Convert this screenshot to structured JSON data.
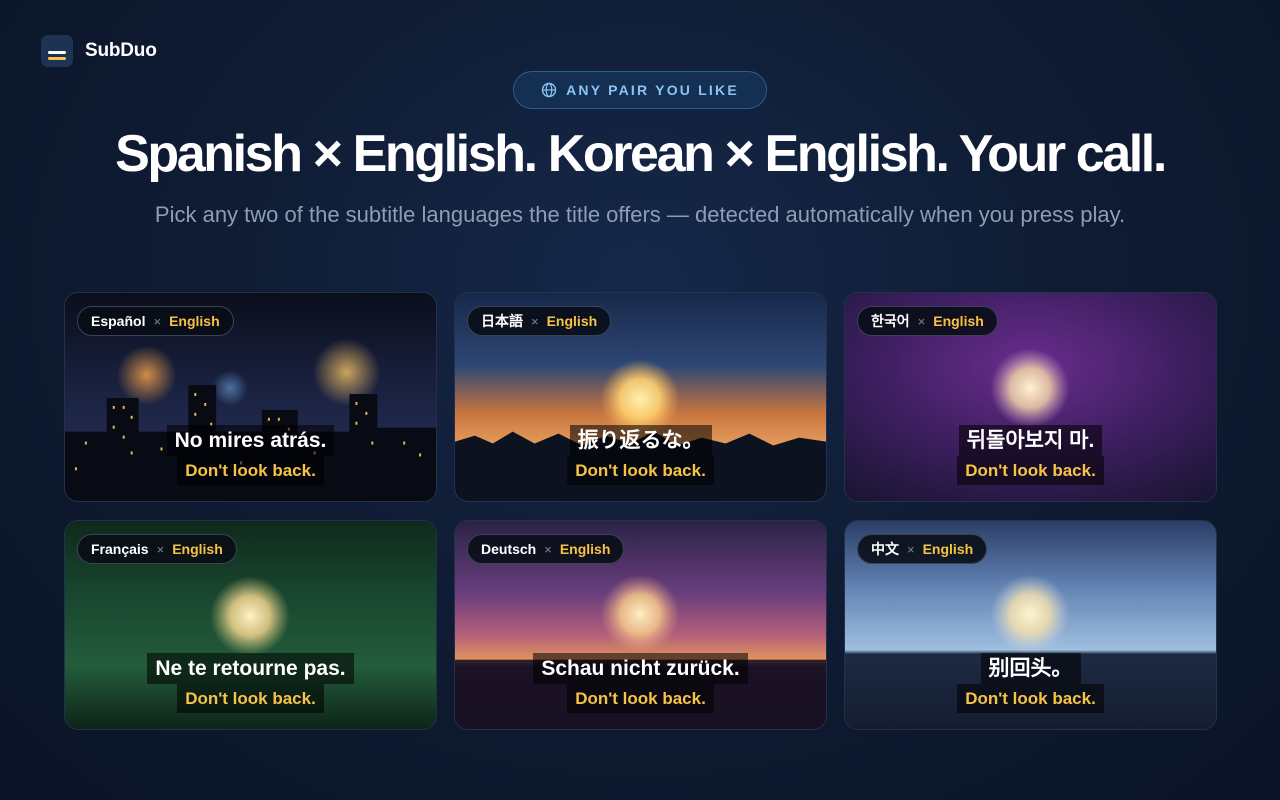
{
  "brand": {
    "name": "SubDuo",
    "logo_icon": "subtitle-lines-icon"
  },
  "pill": {
    "icon": "globe-icon",
    "label": "ANY PAIR YOU LIKE"
  },
  "headline": "Spanish × English. Korean × English. Your call.",
  "subhead": "Pick any two of the subtitle languages the title offers — detected automatically when you press play.",
  "separator": "×",
  "cards": [
    {
      "lang": "Español",
      "target": "English",
      "native": "No mires atrás.",
      "english": "Don't look back."
    },
    {
      "lang": "日本語",
      "target": "English",
      "native": "振り返るな。",
      "english": "Don't look back."
    },
    {
      "lang": "한국어",
      "target": "English",
      "native": "뒤돌아보지 마.",
      "english": "Don't look back."
    },
    {
      "lang": "Français",
      "target": "English",
      "native": "Ne te retourne pas.",
      "english": "Don't look back."
    },
    {
      "lang": "Deutsch",
      "target": "English",
      "native": "Schau nicht zurück.",
      "english": "Don't look back."
    },
    {
      "lang": "中文",
      "target": "English",
      "native": "别回头。",
      "english": "Don't look back."
    }
  ],
  "colors": {
    "accent": "#f6c344",
    "pill_text": "#8cc3f2",
    "subtext": "#8d9db5"
  }
}
